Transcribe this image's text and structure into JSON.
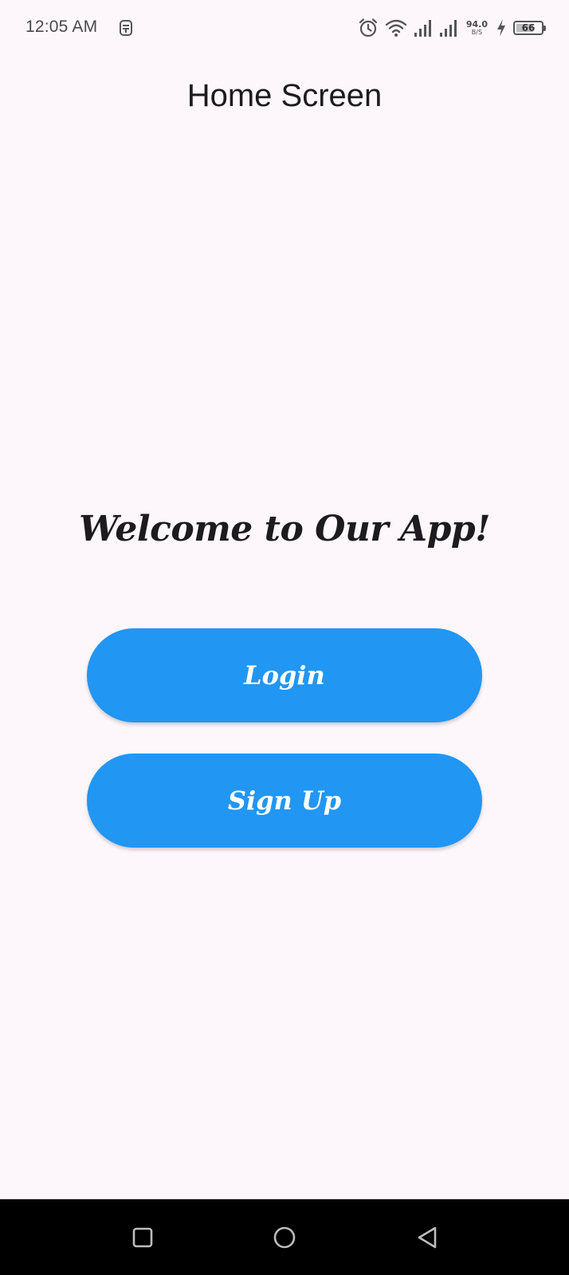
{
  "status_bar": {
    "time": "12:05 AM",
    "net_speed_value": "94.0",
    "net_speed_unit": "B/S",
    "battery_level": "66",
    "icons": [
      "app-notification-icon",
      "alarm-icon",
      "wifi-icon",
      "signal-icon",
      "signal-icon",
      "charging-icon",
      "battery-icon"
    ]
  },
  "app_bar": {
    "title": "Home Screen"
  },
  "main": {
    "welcome_text": "Welcome to Our App!",
    "login_label": "Login",
    "signup_label": "Sign Up"
  },
  "nav_bar": {
    "icons": [
      "recent-apps-icon",
      "home-icon",
      "back-icon"
    ]
  },
  "colors": {
    "background": "#fdf7fc",
    "button": "#2196f3",
    "button_text": "#ffffff",
    "text": "#1d1b20",
    "nav_bar": "#000000"
  }
}
